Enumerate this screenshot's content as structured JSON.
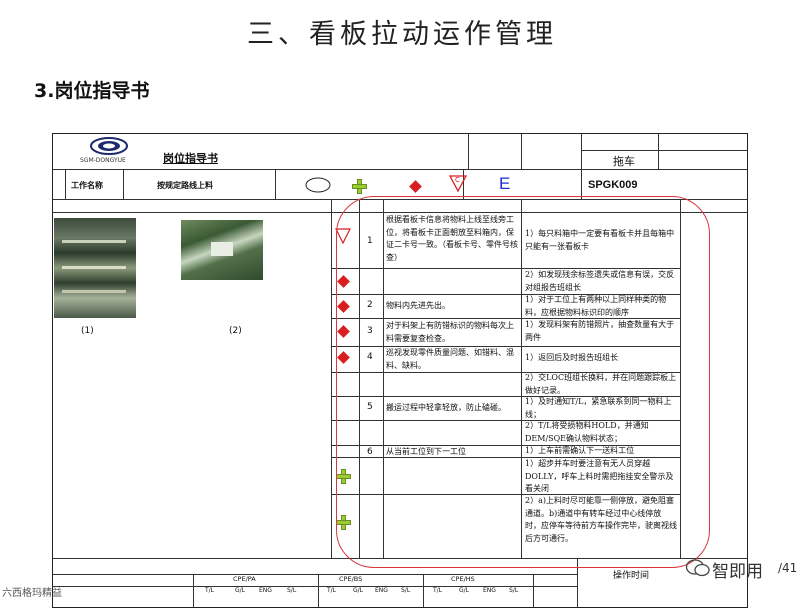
{
  "slide": {
    "title": "三、看板拉动运作管理",
    "section": "3.岗位指导书",
    "page_no": "/41"
  },
  "header": {
    "logo_text": "SGM-DONGYUE",
    "doc_title": "岗位指导书",
    "station_name": "拖车",
    "work_name_label": "工作名称",
    "work_name_value": "按规定路线上料",
    "doc_no_value": "SPGK009",
    "grade_letter": "E",
    "symbol_c": "C"
  },
  "photos": {
    "label_1": "(1)",
    "label_2": "(2)"
  },
  "steps": [
    {
      "no": "1",
      "content": "根据看板卡信息将物料上线至线旁工位，将看板卡正面朝放至料箱内，保证二卡号一致。（看板卡号、零件号核查）",
      "notes": "1）每只料箱中一定要有看板卡并且每箱中只能有一张看板卡"
    },
    {
      "no": "",
      "content": "",
      "notes": "2）如发现残余标签遗失或信息有误，交反对组报告班组长"
    },
    {
      "no": "2",
      "content": "物料内先进先出。",
      "notes": "1）对于工位上有两种以上同样种类的物料，应根据物料标识印的顺序"
    },
    {
      "no": "3",
      "content": "对于料架上有防错标识的物料每次上料需要复查检查。",
      "notes": "1）发现料架有防错照片，抽查数量有大于两件"
    },
    {
      "no": "4",
      "content": "巡视发现零件质量问题、如错料、混料、缺料。",
      "notes": "1）返回后及时报告班组长"
    },
    {
      "no": "",
      "content": "",
      "notes": "2）交LOC班组长换料，并在问题跟踪板上做好记录。"
    },
    {
      "no": "5",
      "content": "搬运过程中轻拿轻放，防止磕碰。",
      "notes": "1）及时通知T/L，紧急联系到同一物料上线；"
    },
    {
      "no": "",
      "content": "",
      "notes": "2）T/L将受损物料HOLD，并通知DEM/SQE确认物料状态；"
    },
    {
      "no": "6",
      "content": "从当前工位到下一工位",
      "notes": "1）上车前需确认下一送料工位"
    },
    {
      "no": "",
      "content": "",
      "notes": "1）超步并车时要注意有无人员穿越DOLLY，呼车上料时需把拖挂安全警示及看关闭"
    },
    {
      "no": "",
      "content": "",
      "notes": "2）a)上料时尽可能靠一侧停放，避免阻塞通道。b)通道中有转车经过中心线停放时，应停车等待前方车操作完毕，驶离视线后方可通行。"
    }
  ],
  "footer": {
    "groups": [
      "CPE/PA",
      "CPE/BS",
      "CPE/HS"
    ],
    "cols": [
      "T/L",
      "G/L",
      "ENG",
      "S/L"
    ],
    "operation_time_label": "操作时间"
  },
  "watermark": {
    "left": "六西格玛精益",
    "right": "智即用"
  },
  "colors": {
    "red_box": "#d9363e",
    "diamond": "#d81e1e",
    "cross": "#9acd32",
    "blue_letter": "#1a2fd6"
  }
}
